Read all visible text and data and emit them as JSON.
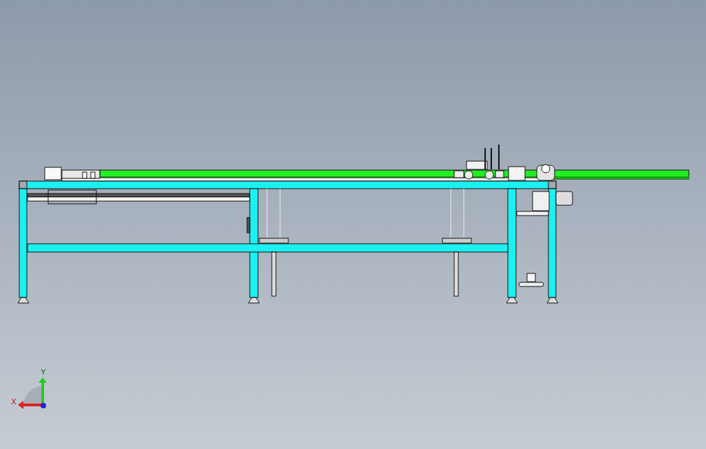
{
  "viewport": {
    "triad": {
      "axes": [
        {
          "kind": "y",
          "label": "Y"
        },
        {
          "kind": "x",
          "label": "X"
        }
      ]
    }
  }
}
